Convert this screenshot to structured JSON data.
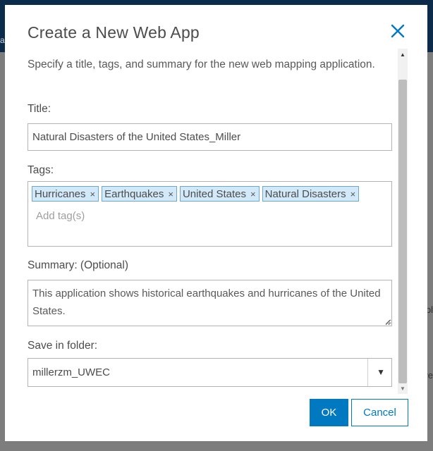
{
  "background": {
    "topbar_fragment": "a",
    "side_fragments": [
      "bl",
      "re"
    ]
  },
  "dialog": {
    "title": "Create a New Web App",
    "close_icon": "close-icon",
    "description": "Specify a title, tags, and summary for the new web mapping application."
  },
  "form": {
    "title_label": "Title:",
    "title_value": "Natural Disasters of the United States_Miller",
    "tags_label": "Tags:",
    "tags": [
      "Hurricanes",
      "Earthquakes",
      "United States",
      "Natural Disasters"
    ],
    "tag_remove_glyph": "×",
    "add_tag_placeholder": "Add tag(s)",
    "summary_label": "Summary: (Optional)",
    "summary_value": "This application shows historical earthquakes and hurricanes of the United States.",
    "folder_label": "Save in folder:",
    "folder_value": "millerzm_UWEC",
    "folder_arrow": "▼"
  },
  "buttons": {
    "ok_label": "OK",
    "cancel_label": "Cancel"
  },
  "colors": {
    "accent": "#0079c1",
    "tag_bg": "#d2e9f9",
    "overlay": "#7d7d7d",
    "topbar": "#0c2b4a"
  }
}
